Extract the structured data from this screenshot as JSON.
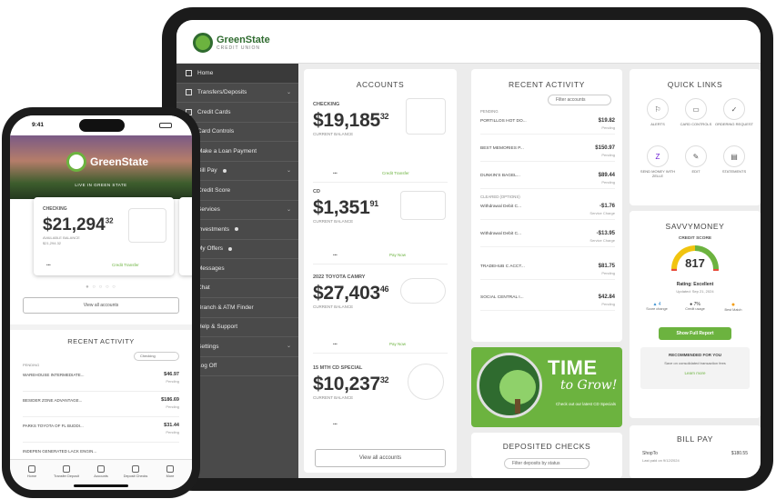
{
  "brand": {
    "name": "GreenState",
    "sub": "CREDIT UNION",
    "tagline": "LIVE IN GREEN STATE"
  },
  "colors": {
    "brand_green": "#6cb33f",
    "dark_green": "#2f6b2f",
    "sidebar": "#4a4a4a"
  },
  "sidebar": {
    "items": [
      {
        "label": "Home",
        "icon": "home-icon"
      },
      {
        "label": "Transfers/Deposits",
        "icon": "transfer-icon",
        "caret": "⌄"
      },
      {
        "label": "Credit Cards",
        "icon": "card-icon"
      },
      {
        "label": "Card Controls",
        "icon": ""
      },
      {
        "label": "Make a Loan Payment",
        "icon": ""
      },
      {
        "label": "Bill Pay",
        "icon": "",
        "caret": "⌄"
      },
      {
        "label": "Credit Score",
        "icon": ""
      },
      {
        "label": "Services",
        "icon": "",
        "caret": "⌄"
      },
      {
        "label": "Investments",
        "icon": ""
      },
      {
        "label": "My Offers",
        "icon": ""
      },
      {
        "label": "Messages",
        "icon": ""
      },
      {
        "label": "Chat",
        "icon": ""
      },
      {
        "label": "Branch & ATM Finder",
        "icon": ""
      },
      {
        "label": "Help & Support",
        "icon": ""
      },
      {
        "label": "Settings",
        "icon": "",
        "caret": "⌄"
      },
      {
        "label": "Log Off",
        "icon": ""
      }
    ]
  },
  "accounts": {
    "title": "ACCOUNTS",
    "list": [
      {
        "name": "CHECKING",
        "balance": "19,185",
        "cents": "32",
        "caption": "CURRENT BALANCE",
        "link": "Credit Transfer",
        "more": "•••"
      },
      {
        "name": "CD",
        "balance": "1,351",
        "cents": "91",
        "caption": "CURRENT BALANCE",
        "link": "Pay Now",
        "more": "•••"
      },
      {
        "name": "2022 TOYOTA CAMRY",
        "balance": "27,403",
        "cents": "46",
        "caption": "CURRENT BALANCE",
        "link": "Pay Now",
        "more": "•••"
      },
      {
        "name": "15 MTH CD SPECIAL",
        "balance": "10,237",
        "cents": "32",
        "caption": "CURRENT BALANCE",
        "link": "",
        "more": "•••"
      }
    ],
    "view_all": "View all accounts"
  },
  "activity": {
    "title": "RECENT ACTIVITY",
    "filter": "Filter accounts",
    "pending_header": "PENDING",
    "cleared_header": "CLEARED (OPTIONS)",
    "rows": [
      {
        "name": "PORTILLOS HOT DO...",
        "amount": "$19.82",
        "sub": "Pending"
      },
      {
        "name": "BEST MEMORIES P...",
        "amount": "$150.97",
        "sub": "Pending"
      },
      {
        "name": "DUNKIN'S BAGEL...",
        "amount": "$89.44",
        "sub": "Pending"
      },
      {
        "name": "Withdrawal Debit C...",
        "amount": "-$1.76",
        "sub": "Service Charge"
      },
      {
        "name": "Withdrawal Debit C...",
        "amount": "-$13.95",
        "sub": "Service Charge"
      },
      {
        "name": "TRADEHUB C ACCT...",
        "amount": "$81.75",
        "sub": "Pending"
      },
      {
        "name": "SOCIAL CENTRAL I...",
        "amount": "$42.84",
        "sub": "Pending"
      }
    ]
  },
  "promo": {
    "title": "TIME",
    "script": "to Grow!",
    "small": "Check out our latest CD Specials"
  },
  "deposited": {
    "title": "DEPOSITED CHECKS",
    "filter": "Filter deposits by status"
  },
  "quick_links": {
    "title": "QUICK LINKS",
    "items": [
      {
        "label": "ALERTS",
        "icon": "bell-icon",
        "glyph": "⚐"
      },
      {
        "label": "CARD CONTROLS",
        "icon": "card-controls-icon",
        "glyph": "▭"
      },
      {
        "label": "ORDERING REQUEST",
        "icon": "check-icon",
        "glyph": "✓"
      },
      {
        "label": "SEND MONEY WITH ZELLE",
        "icon": "zelle-icon",
        "glyph": "Z"
      },
      {
        "label": "EDIT",
        "icon": "edit-icon",
        "glyph": "✎"
      },
      {
        "label": "STATEMENTS",
        "icon": "statement-icon",
        "glyph": "▤"
      }
    ]
  },
  "savvy": {
    "title": "SAVVYMONEY",
    "score_label": "CREDIT SCORE",
    "score": "817",
    "rating": "Rating: Excellent",
    "updated": "Updated: Sep 21, 2024",
    "stats": [
      {
        "value": "▲ 4",
        "label": "Score change"
      },
      {
        "value": "● 7%",
        "label": "Credit usage"
      },
      {
        "value": "●",
        "label": "Best Match"
      }
    ],
    "button": "Show Full Report",
    "rec_title": "RECOMMENDED FOR YOU",
    "rec_text": "Save on consolidated transaction fees",
    "rec_link": "Learn more"
  },
  "billpay": {
    "title": "BILL PAY",
    "payee": "ShopTo",
    "amount": "$180.55",
    "sub": "Last paid on 9/12/2024"
  },
  "phone": {
    "time": "9:41",
    "card": {
      "name": "CHECKING",
      "balance": "21,294",
      "cents": "32",
      "caption": "AVAILABLE BALANCE",
      "sub": "$21,294.32",
      "link": "Credit Transfer",
      "more": "•••"
    },
    "dots": "● ○ ○ ○ ○",
    "view_all": "View all accounts",
    "ra_title": "RECENT ACTIVITY",
    "ra_filter": "Checking",
    "ra_header": "PENDING",
    "rows": [
      {
        "name": "WAREHOUSE INTERMEDIATE...",
        "amount": "$46.97",
        "sub": "Pending"
      },
      {
        "name": "BESIDER ZONE ADVANTAGE...",
        "amount": "$186.69",
        "sub": "Pending"
      },
      {
        "name": "PARKS TOYOTA OF FL BUDDI...",
        "amount": "$31.44",
        "sub": "Pending"
      },
      {
        "name": "INDEPEN GENERATED LACK ENGIN...",
        "amount": "",
        "sub": ""
      }
    ],
    "tabs": [
      {
        "label": "Home"
      },
      {
        "label": "Transfer Deposit"
      },
      {
        "label": "Accounts"
      },
      {
        "label": "Deposit Checks"
      },
      {
        "label": "More"
      }
    ]
  }
}
